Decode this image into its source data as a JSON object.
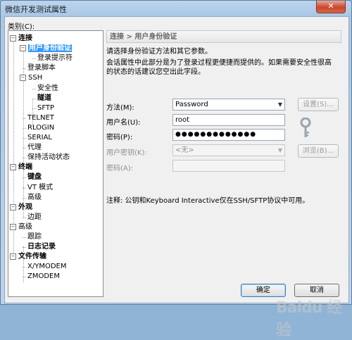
{
  "window": {
    "title": "微信开发测试属性",
    "close_glyph": "✕"
  },
  "category_label": "类别(C):",
  "tree": [
    {
      "label": "连接",
      "level": 0,
      "expander": "−",
      "bold": true
    },
    {
      "label": "用户身份验证",
      "level": 1,
      "expander": "−",
      "bold": true,
      "selected": true
    },
    {
      "label": "登录提示符",
      "level": 2
    },
    {
      "label": "登录脚本",
      "level": 1
    },
    {
      "label": "SSH",
      "level": 1,
      "expander": "−"
    },
    {
      "label": "安全性",
      "level": 2
    },
    {
      "label": "隧道",
      "level": 2,
      "bold": true
    },
    {
      "label": "SFTP",
      "level": 2
    },
    {
      "label": "TELNET",
      "level": 1
    },
    {
      "label": "RLOGIN",
      "level": 1
    },
    {
      "label": "SERIAL",
      "level": 1
    },
    {
      "label": "代理",
      "level": 1
    },
    {
      "label": "保持活动状态",
      "level": 1
    },
    {
      "label": "终端",
      "level": 0,
      "expander": "−",
      "bold": true
    },
    {
      "label": "键盘",
      "level": 1,
      "bold": true
    },
    {
      "label": "VT 模式",
      "level": 1
    },
    {
      "label": "高级",
      "level": 1
    },
    {
      "label": "外观",
      "level": 0,
      "expander": "−",
      "bold": true
    },
    {
      "label": "边距",
      "level": 1
    },
    {
      "label": "高级",
      "level": 0,
      "expander": "−"
    },
    {
      "label": "跟踪",
      "level": 1
    },
    {
      "label": "日志记录",
      "level": 1,
      "bold": true
    },
    {
      "label": "文件传输",
      "level": 0,
      "expander": "−",
      "bold": true
    },
    {
      "label": "X/YMODEM",
      "level": 1
    },
    {
      "label": "ZMODEM",
      "level": 1
    }
  ],
  "panel": {
    "header": "连接 > 用户身份验证",
    "desc1": "请选择身份验证方法和其它参数。",
    "desc2_line1": "会话属性中此部分是为了登录过程更便捷而提供的。如果需要安全性很高",
    "desc2_line2": "的状态的话建议您空出此字段。",
    "method_label": "方法(M):",
    "method_value": "Password",
    "settings_button": "设置(S)...",
    "username_label": "用户名(U):",
    "username_value": "root",
    "password_label": "密码(P):",
    "password_value": "●●●●●●●●●●●●●",
    "user_key_label": "用户密钥(K):",
    "user_key_value": "<无>",
    "browse_button": "浏览(B)...",
    "passphrase_label": "密码(A):",
    "note": "注释: 公钥和Keyboard Interactive仅在SSH/SFTP协议中可用。"
  },
  "buttons": {
    "ok": "确定",
    "cancel": "取消"
  },
  "watermark": "Baidu 经验",
  "colors": {
    "selection": "#3399ff",
    "title_bar": "#a9c6e4",
    "close": "#c9462b"
  }
}
